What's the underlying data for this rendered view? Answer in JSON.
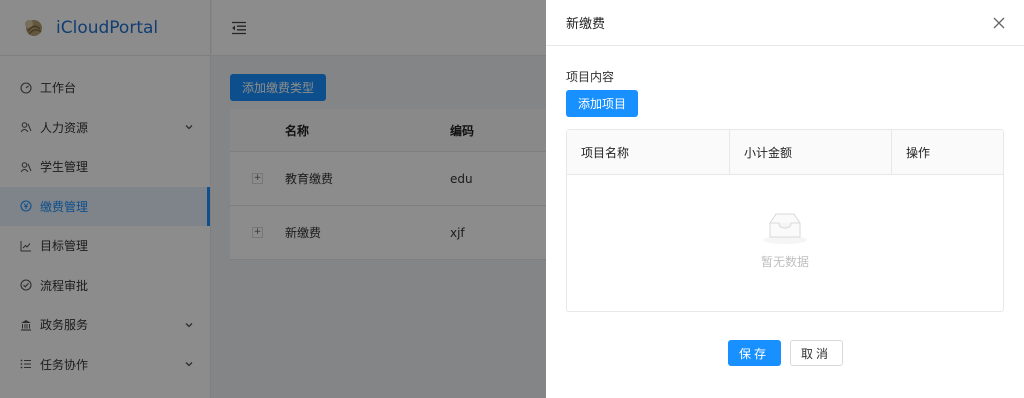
{
  "app": {
    "title": "iCloudPortal"
  },
  "sidebar": {
    "items": [
      {
        "label": "工作台",
        "icon": "dashboard-icon"
      },
      {
        "label": "人力资源",
        "icon": "users-icon",
        "expandable": true
      },
      {
        "label": "学生管理",
        "icon": "users-icon"
      },
      {
        "label": "缴费管理",
        "icon": "yen-icon",
        "active": true
      },
      {
        "label": "目标管理",
        "icon": "line-chart-icon"
      },
      {
        "label": "流程审批",
        "icon": "check-circle-icon"
      },
      {
        "label": "政务服务",
        "icon": "bank-icon",
        "expandable": true
      },
      {
        "label": "任务协作",
        "icon": "list-icon",
        "expandable": true
      }
    ]
  },
  "main": {
    "add_type_button": "添加缴费类型",
    "table": {
      "columns": [
        "名称",
        "编码"
      ],
      "rows": [
        {
          "name": "教育缴费",
          "code": "edu"
        },
        {
          "name": "新缴费",
          "code": "xjf"
        }
      ]
    }
  },
  "drawer": {
    "title": "新缴费",
    "section_label": "项目内容",
    "add_item_button": "添加项目",
    "table": {
      "columns": [
        "项目名称",
        "小计金额",
        "操作"
      ],
      "empty_text": "暂无数据"
    },
    "save_button": "保存",
    "cancel_button": "取消"
  },
  "colors": {
    "primary": "#1890ff",
    "brand_text": "#1f6fd2",
    "overlay": "rgba(0,0,0,0.45)"
  }
}
